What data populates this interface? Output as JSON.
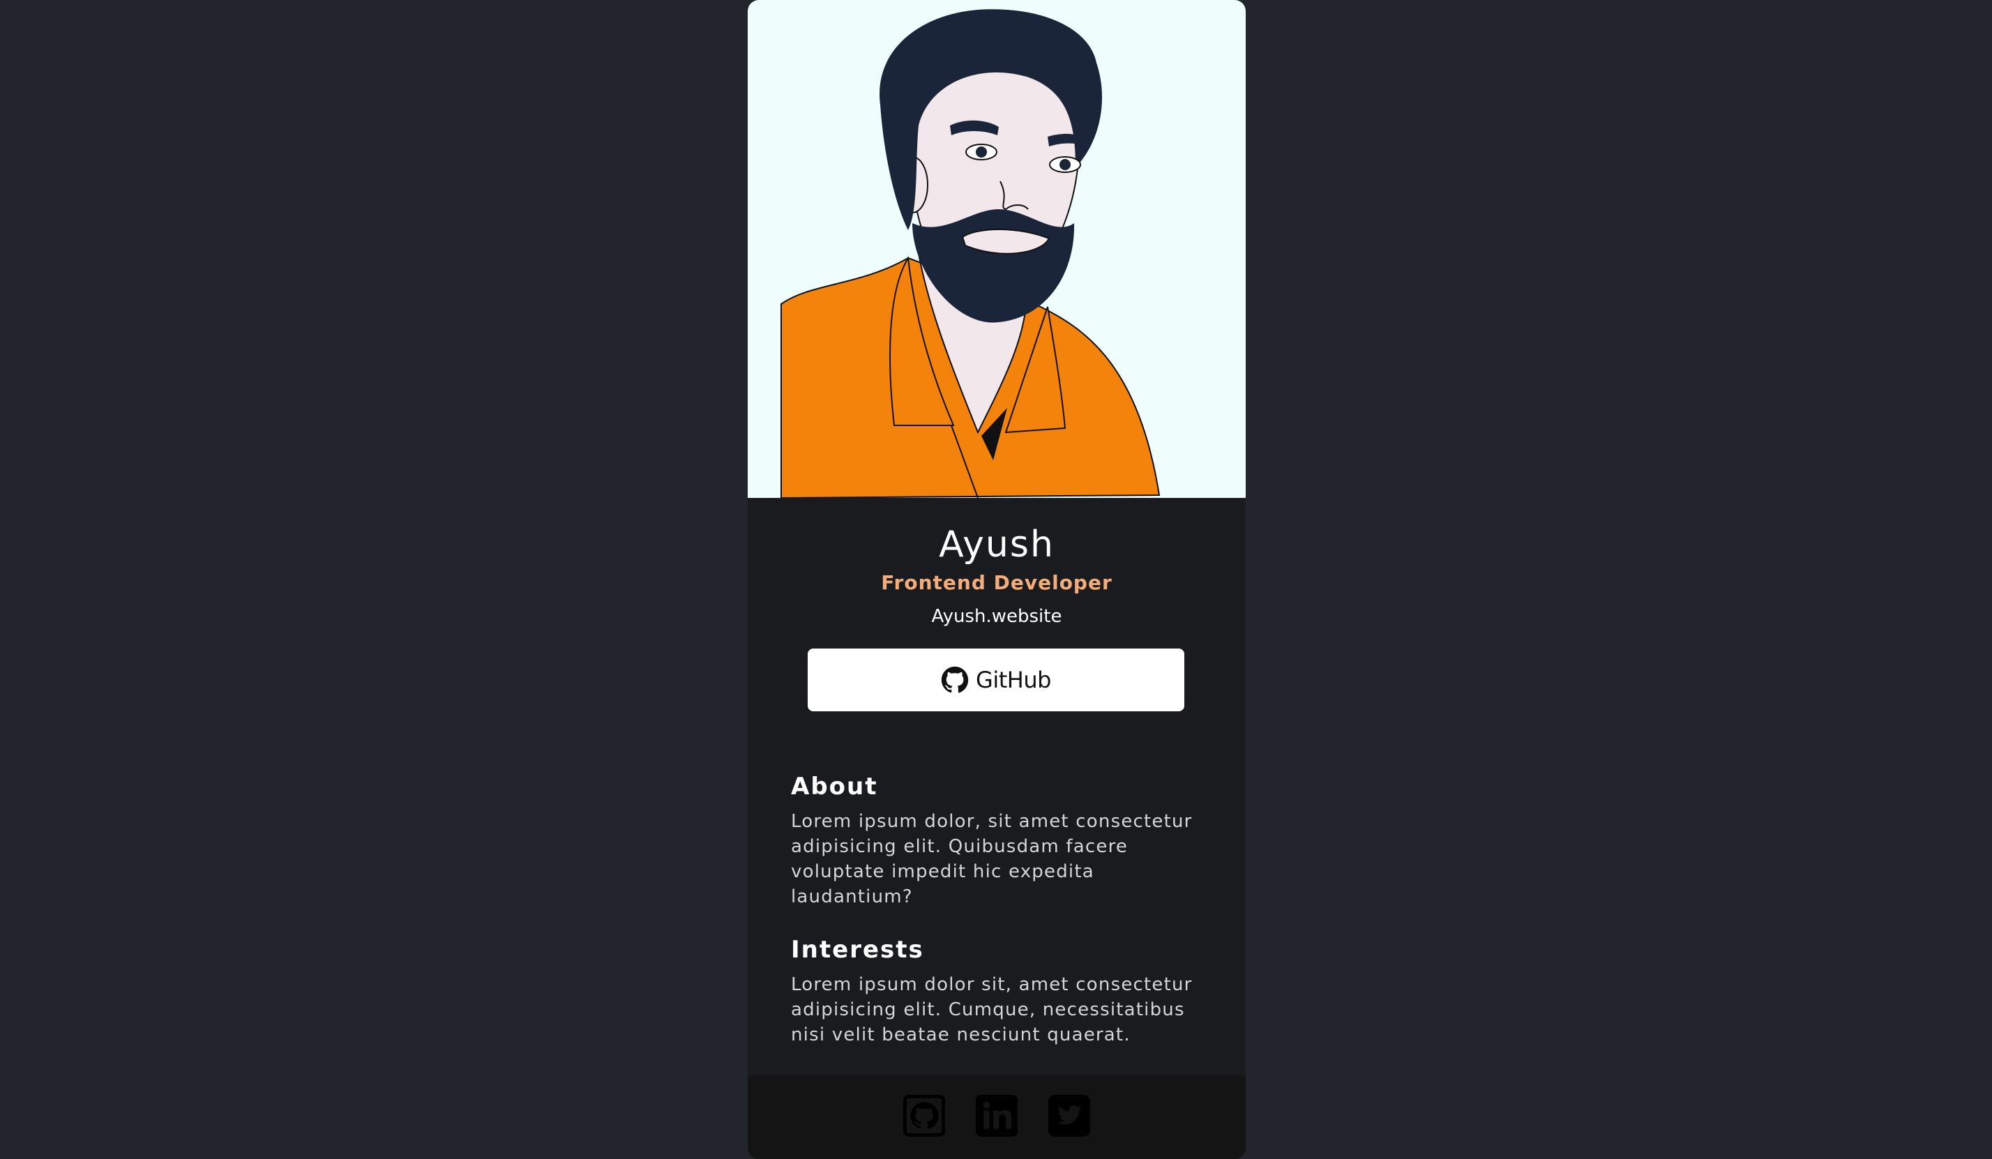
{
  "profile": {
    "name": "Ayush",
    "role": "Frontend Developer",
    "website": "Ayush.website",
    "github_button_label": "GitHub",
    "portrait_icon": "portrait-illustration"
  },
  "about": {
    "heading": "About",
    "text": "Lorem ipsum dolor, sit amet consectetur adipisicing elit. Quibusdam facere voluptate impedit hic expedita laudantium?"
  },
  "interests": {
    "heading": "Interests",
    "text": "Lorem ipsum dolor sit, amet consectetur adipisicing elit. Cumque, necessitatibus nisi velit beatae nesciunt quaerat."
  },
  "footer": {
    "links": [
      {
        "icon": "github-icon"
      },
      {
        "icon": "linkedin-icon"
      },
      {
        "icon": "twitter-icon"
      }
    ]
  },
  "colors": {
    "page_background": "#23252c",
    "card_background": "#1a1b1e",
    "portrait_background": "#effdfd",
    "accent": "#f3ac7b",
    "shirt": "#f3830a",
    "hair": "#1b253a",
    "footer_background": "#141415"
  }
}
